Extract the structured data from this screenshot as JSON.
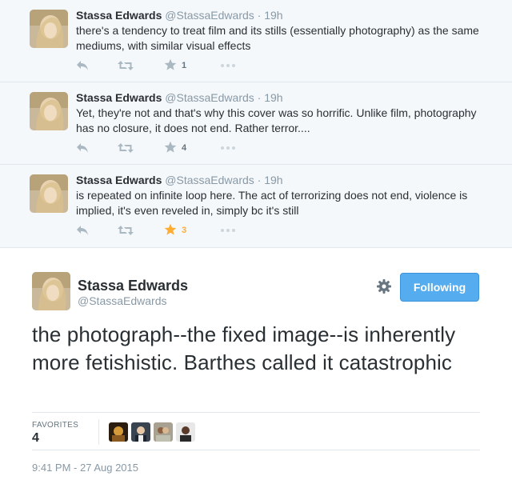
{
  "conversation": [
    {
      "name": "Stassa Edwards",
      "handle": "@StassaEdwards",
      "separator": "·",
      "time": "19h",
      "text": "there's a tendency to treat film and its stills (essentially photography) as the same mediums, with similar visual effects",
      "favorites": "1",
      "favorited": false
    },
    {
      "name": "Stassa Edwards",
      "handle": "@StassaEdwards",
      "separator": "·",
      "time": "19h",
      "text": "Yet, they're not and that's why this cover was so horrific. Unlike film, photography has no closure, it does not end. Rather terror....",
      "favorites": "4",
      "favorited": false
    },
    {
      "name": "Stassa Edwards",
      "handle": "@StassaEdwards",
      "separator": "·",
      "time": "19h",
      "text": "is repeated on infinite loop here. The act of terrorizing does not end, violence is implied, it's even reveled in, simply bc it's still",
      "favorites": "3",
      "favorited": true
    }
  ],
  "main_tweet": {
    "name": "Stassa Edwards",
    "handle": "@StassaEdwards",
    "follow_label": "Following",
    "text": "the photograph--the fixed image--is inherently more fetishistic. Barthes called it catastrophic",
    "favorites_label": "FAVORITES",
    "favorites_count": "4",
    "timestamp": "9:41 PM - 27 Aug 2015"
  },
  "icons": {
    "reply": "reply-icon",
    "retweet": "retweet-icon",
    "favorite": "star-icon",
    "more": "more-dots-icon",
    "settings": "gear-icon"
  },
  "colors": {
    "follow_button": "#55acee",
    "favorited_star": "#ffac33",
    "muted_icon": "#aab8c2",
    "conversation_bg": "#f5f8fa"
  }
}
